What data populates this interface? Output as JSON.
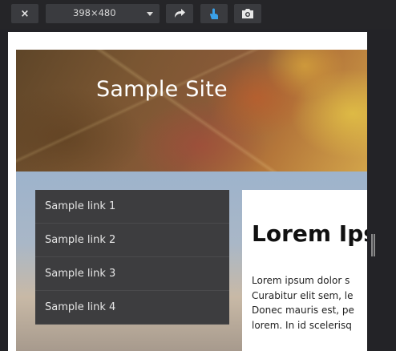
{
  "toolbar": {
    "close_label": "×",
    "device_size": "398×480",
    "rotate_icon": "rotate-icon",
    "touch_icon": "touch-icon",
    "screenshot_icon": "camera-icon"
  },
  "site": {
    "title": "Sample Site",
    "nav_links": [
      "Sample link 1",
      "Sample link 2",
      "Sample link 3",
      "Sample link 4"
    ],
    "heading": "Lorem Ips",
    "paragraph_lines": [
      "Lorem ipsum dolor s",
      "Curabitur elit sem, le",
      "Donec mauris est, pe",
      "lorem. In id scelerisq"
    ]
  },
  "colors": {
    "toolbar_bg": "#252528",
    "button_bg": "#3a3b3f",
    "touch_accent": "#3aa0e8",
    "nav_bg": "#3d3d3f"
  }
}
